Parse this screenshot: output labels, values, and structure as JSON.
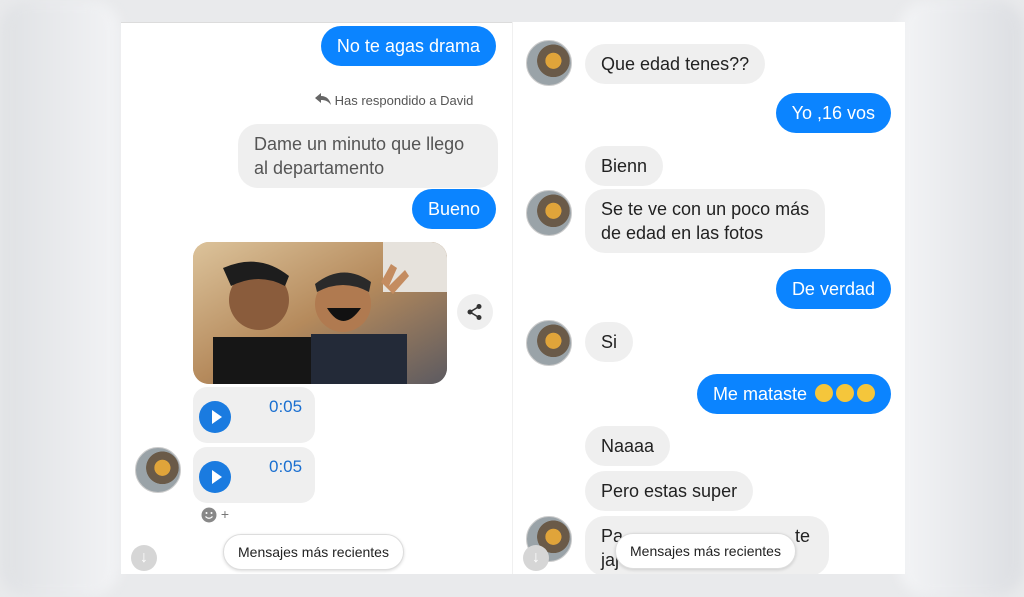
{
  "colors": {
    "outgoing": "#0b84ff",
    "incoming": "#efefef",
    "accent": "#1a7be0"
  },
  "left_chat": {
    "messages": [
      {
        "type": "outgoing",
        "text": "No te agas drama"
      },
      {
        "type": "reply_note",
        "text": "Has respondido a David"
      },
      {
        "type": "incoming",
        "text_line1": "Dame un minuto que llego",
        "text_line2": "al departamento"
      },
      {
        "type": "outgoing",
        "text": "Bueno"
      },
      {
        "type": "photo"
      },
      {
        "type": "audio",
        "duration": "0:05"
      },
      {
        "type": "audio",
        "duration": "0:05"
      }
    ],
    "reply_icon": "reply-arrow-icon",
    "share_icon": "share-icon",
    "react_icon": "smiley-add-icon",
    "react_text": "+",
    "newer_messages_label": "Mensajes más recientes"
  },
  "right_chat": {
    "messages": [
      {
        "type": "incoming",
        "text": "Que edad tenes??"
      },
      {
        "type": "outgoing",
        "text": "Yo ,16 vos"
      },
      {
        "type": "incoming",
        "text": "Bienn"
      },
      {
        "type": "incoming",
        "text_line1": "Se te ve con un poco más",
        "text_line2": "de edad en las fotos"
      },
      {
        "type": "outgoing",
        "text": "De verdad"
      },
      {
        "type": "incoming",
        "text": "Si"
      },
      {
        "type": "outgoing",
        "text": "Me mataste",
        "emoji": "laughing-emoji x3"
      },
      {
        "type": "incoming",
        "text": "Naaaa"
      },
      {
        "type": "incoming",
        "text": "Pero estas super"
      },
      {
        "type": "incoming",
        "text_partial1": "Pa",
        "text_partial2": "te",
        "text_partial3": "jaj"
      }
    ],
    "newer_messages_label": "Mensajes más recientes"
  }
}
